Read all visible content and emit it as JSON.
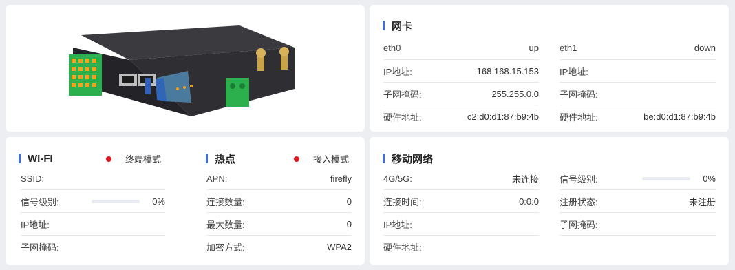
{
  "nic": {
    "title": "网卡",
    "eth0": {
      "label": "eth0",
      "status": "up",
      "ip_label": "IP地址:",
      "ip": "168.168.15.153",
      "mask_label": "子网掩码:",
      "mask": "255.255.0.0",
      "mac_label": "硬件地址:",
      "mac": "c2:d0:d1:87:b9:4b"
    },
    "eth1": {
      "label": "eth1",
      "status": "down",
      "ip_label": "IP地址:",
      "ip": "",
      "mask_label": "子网掩码:",
      "mask": "",
      "mac_label": "硬件地址:",
      "mac": "be:d0:d1:87:b9:4b"
    }
  },
  "wifi": {
    "title": "WI-FI",
    "mode": "终端模式",
    "mode_color": "#e0161e",
    "ssid_label": "SSID:",
    "ssid": "",
    "signal_label": "信号级别:",
    "signal": "0%",
    "signal_fraction": 0,
    "ip_label": "IP地址:",
    "ip": "",
    "mask_label": "子网掩码:",
    "mask": ""
  },
  "hotspot": {
    "title": "热点",
    "mode": "接入模式",
    "mode_color": "#e0161e",
    "apn_label": "APN:",
    "apn": "firefly",
    "conn_label": "连接数量:",
    "conn": "0",
    "max_label": "最大数量:",
    "max": "0",
    "enc_label": "加密方式:",
    "enc": "WPA2"
  },
  "mobile": {
    "title": "移动网络",
    "net_label": "4G/5G:",
    "net": "未连接",
    "conn_time_label": "连接时间:",
    "conn_time": "0:0:0",
    "ip_label": "IP地址:",
    "ip": "",
    "mac_label": "硬件地址:",
    "mac": "",
    "signal_label": "信号级别:",
    "signal": "0%",
    "signal_fraction": 0,
    "reg_label": "注册状态:",
    "reg": "未注册",
    "mask_label": "子网掩码:",
    "mask": ""
  },
  "colors": {
    "accent": "#3d6fe0",
    "status_red": "#e0161e",
    "device_body": "#2c2c30",
    "terminal_green": "#28b04a",
    "terminal_orange": "#f0a020"
  },
  "device_image": {
    "icon": "router-device-illustration"
  }
}
